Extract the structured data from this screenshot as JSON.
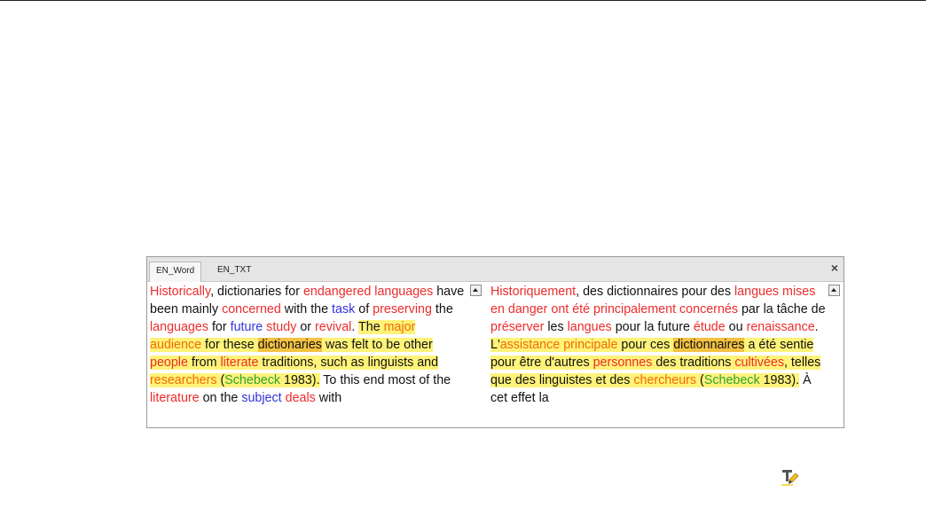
{
  "tabs": [
    {
      "label": "EN_Word",
      "active": true
    },
    {
      "label": "EN_TXT",
      "active": false
    }
  ],
  "close_label": "×",
  "left_pane": {
    "segments": [
      {
        "t": "Historically",
        "c": "r"
      },
      {
        "t": ", dictionaries for ",
        "c": ""
      },
      {
        "t": "endangered",
        "c": "r"
      },
      {
        "t": " ",
        "c": ""
      },
      {
        "t": "languages",
        "c": "r"
      },
      {
        "t": " have been mainly ",
        "c": ""
      },
      {
        "t": "concerned",
        "c": "r"
      },
      {
        "t": " with the ",
        "c": ""
      },
      {
        "t": "task",
        "c": "b"
      },
      {
        "t": " of ",
        "c": ""
      },
      {
        "t": "preserving",
        "c": "r"
      },
      {
        "t": " the ",
        "c": ""
      },
      {
        "t": "languages",
        "c": "r"
      },
      {
        "t": " for ",
        "c": ""
      },
      {
        "t": "future",
        "c": "b"
      },
      {
        "t": " ",
        "c": ""
      },
      {
        "t": "study",
        "c": "r"
      },
      {
        "t": " or ",
        "c": ""
      },
      {
        "t": "revival",
        "c": "r"
      },
      {
        "t": ". ",
        "c": ""
      },
      {
        "t": "The ",
        "c": "y"
      },
      {
        "t": "major audience",
        "c": "y o"
      },
      {
        "t": " for these ",
        "c": "y"
      },
      {
        "t": "dictionaries",
        "c": "yd"
      },
      {
        "t": " was felt to be other ",
        "c": "y"
      },
      {
        "t": "people",
        "c": "y r"
      },
      {
        "t": " from ",
        "c": "y"
      },
      {
        "t": "literate",
        "c": "y r"
      },
      {
        "t": " traditions, such as linguists and ",
        "c": "y"
      },
      {
        "t": "researchers",
        "c": "y o"
      },
      {
        "t": " (",
        "c": "y"
      },
      {
        "t": "Schebeck",
        "c": "y g"
      },
      {
        "t": " 1983).",
        "c": "y"
      },
      {
        "t": " To this end most of the ",
        "c": ""
      },
      {
        "t": "literature",
        "c": "r"
      },
      {
        "t": " on the ",
        "c": ""
      },
      {
        "t": "subject",
        "c": "b"
      },
      {
        "t": " ",
        "c": ""
      },
      {
        "t": "deals",
        "c": "r"
      },
      {
        "t": " with",
        "c": ""
      }
    ]
  },
  "right_pane": {
    "segments": [
      {
        "t": "Historiquement",
        "c": "r"
      },
      {
        "t": ", des dictionnaires pour des ",
        "c": ""
      },
      {
        "t": "langues mises en danger ont été principalement",
        "c": "r"
      },
      {
        "t": " ",
        "c": ""
      },
      {
        "t": "concernés",
        "c": "r"
      },
      {
        "t": " par la tâche de ",
        "c": ""
      },
      {
        "t": "préserver",
        "c": "r"
      },
      {
        "t": " les ",
        "c": ""
      },
      {
        "t": "langues",
        "c": "r"
      },
      {
        "t": " pour la future ",
        "c": ""
      },
      {
        "t": "étude",
        "c": "r"
      },
      {
        "t": " ou ",
        "c": ""
      },
      {
        "t": "renaissance",
        "c": "r"
      },
      {
        "t": ". ",
        "c": ""
      },
      {
        "t": "L'",
        "c": "y"
      },
      {
        "t": "assistance principale",
        "c": "y o"
      },
      {
        "t": " pour ces ",
        "c": "y"
      },
      {
        "t": "dictionnaires",
        "c": "yd"
      },
      {
        "t": " a été sentie pour être d'autres ",
        "c": "y"
      },
      {
        "t": "personnes",
        "c": "y r"
      },
      {
        "t": " des traditions ",
        "c": "y"
      },
      {
        "t": "cultivées",
        "c": "y r"
      },
      {
        "t": ", telles que des linguistes et des ",
        "c": "y"
      },
      {
        "t": "chercheurs",
        "c": "y o"
      },
      {
        "t": " (",
        "c": "y"
      },
      {
        "t": "Schebeck",
        "c": "y g"
      },
      {
        "t": " 1983).",
        "c": "y"
      },
      {
        "t": " À cet effet la",
        "c": ""
      }
    ]
  },
  "icons": {
    "scroll_up": "scroll-up-arrow-icon",
    "tool": "text-highlight-tool-icon"
  }
}
